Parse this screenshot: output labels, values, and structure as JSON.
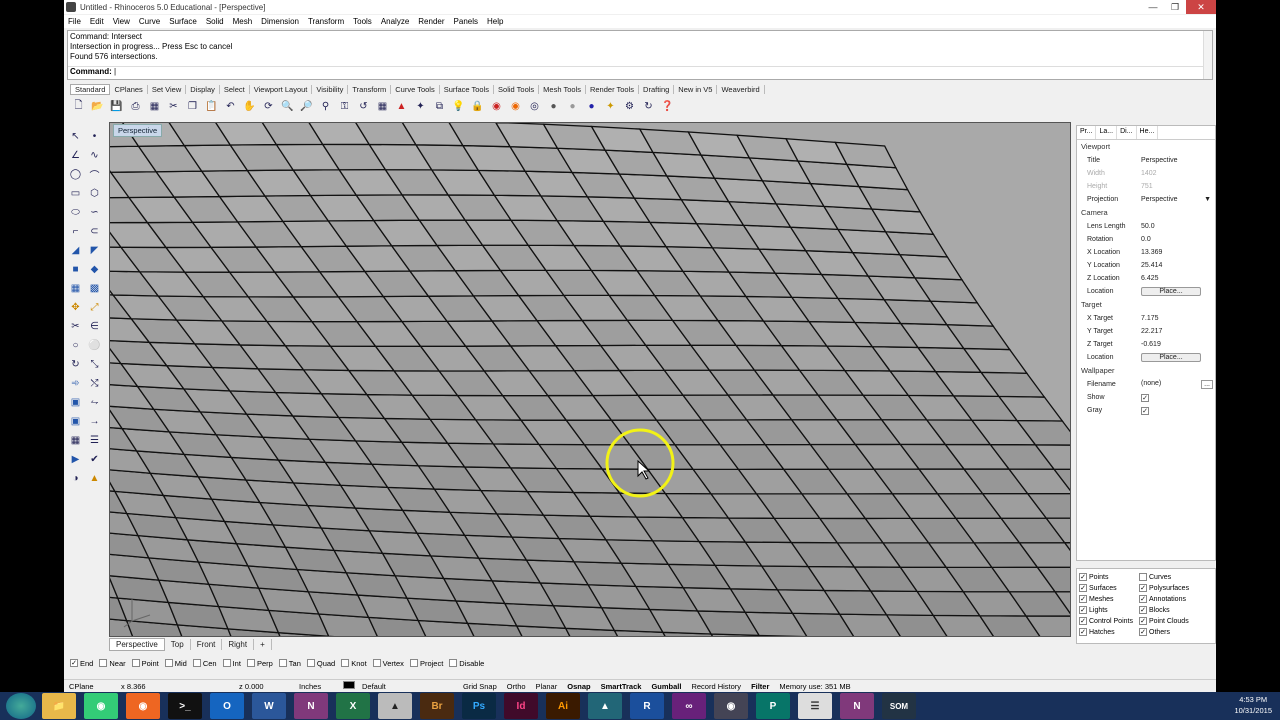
{
  "window": {
    "title": "Untitled - Rhinoceros 5.0 Educational - [Perspective]"
  },
  "menu": [
    "File",
    "Edit",
    "View",
    "Curve",
    "Surface",
    "Solid",
    "Mesh",
    "Dimension",
    "Transform",
    "Tools",
    "Analyze",
    "Render",
    "Panels",
    "Help"
  ],
  "command": {
    "history": [
      "Command: Intersect",
      "Intersection in progress... Press Esc to cancel",
      "Found 576 intersections."
    ],
    "prompt_label": "Command:"
  },
  "toolbar_tabs": [
    "Standard",
    "CPlanes",
    "Set View",
    "Display",
    "Select",
    "Viewport Layout",
    "Visibility",
    "Transform",
    "Curve Tools",
    "Surface Tools",
    "Solid Tools",
    "Mesh Tools",
    "Render Tools",
    "Drafting",
    "New in V5",
    "Weaverbird"
  ],
  "viewport": {
    "label": "Perspective"
  },
  "view_tabs": [
    "Perspective",
    "Top",
    "Front",
    "Right",
    "+"
  ],
  "osnaps": [
    {
      "label": "End",
      "checked": true
    },
    {
      "label": "Near",
      "checked": false
    },
    {
      "label": "Point",
      "checked": false
    },
    {
      "label": "Mid",
      "checked": false
    },
    {
      "label": "Cen",
      "checked": false
    },
    {
      "label": "Int",
      "checked": false
    },
    {
      "label": "Perp",
      "checked": false
    },
    {
      "label": "Tan",
      "checked": false
    },
    {
      "label": "Quad",
      "checked": false
    },
    {
      "label": "Knot",
      "checked": false
    },
    {
      "label": "Vertex",
      "checked": false
    },
    {
      "label": "Project",
      "checked": false
    },
    {
      "label": "Disable",
      "checked": false
    }
  ],
  "status": {
    "cplane": "CPlane",
    "x": "x 8.366",
    "z": "z 0.000",
    "units": "Inches",
    "layer": "Default",
    "grid_snap": "Grid Snap",
    "ortho": "Ortho",
    "planar": "Planar",
    "osnap": "Osnap",
    "smarttrack": "SmartTrack",
    "gumball": "Gumball",
    "record_history": "Record History",
    "filter": "Filter",
    "memory": "Memory use: 351 MB"
  },
  "properties": {
    "tabs": [
      "Pr...",
      "La...",
      "Di...",
      "He..."
    ],
    "viewport_header": "Viewport",
    "title_k": "Title",
    "title_v": "Perspective",
    "width_k": "Width",
    "width_v": "1402",
    "height_k": "Height",
    "height_v": "751",
    "projection_k": "Projection",
    "projection_v": "Perspective",
    "camera_header": "Camera",
    "lens_k": "Lens Length",
    "lens_v": "50.0",
    "rotation_k": "Rotation",
    "rotation_v": "0.0",
    "xloc_k": "X Location",
    "xloc_v": "13.369",
    "yloc_k": "Y Location",
    "yloc_v": "25.414",
    "zloc_k": "Z Location",
    "zloc_v": "6.425",
    "location_k": "Location",
    "place_btn": "Place...",
    "target_header": "Target",
    "xt_k": "X Target",
    "xt_v": "7.175",
    "yt_k": "Y Target",
    "yt_v": "22.217",
    "zt_k": "Z Target",
    "zt_v": "-0.619",
    "tlocation_k": "Location",
    "tplace_btn": "Place...",
    "wallpaper_header": "Wallpaper",
    "filename_k": "Filename",
    "filename_v": "(none)",
    "show_k": "Show",
    "gray_k": "Gray"
  },
  "filter_items": [
    "Points",
    "Curves",
    "Surfaces",
    "Polysurfaces",
    "Meshes",
    "Annotations",
    "Lights",
    "Blocks",
    "Control Points",
    "Point Clouds",
    "Hatches",
    "Others"
  ],
  "filter_checked": [
    true,
    false,
    true,
    true,
    true,
    true,
    true,
    true,
    true,
    true,
    true,
    true
  ],
  "taskbar": {
    "time": "4:53 PM",
    "date": "10/31/2015"
  },
  "colors": {
    "viewport_bg": "#a9a9a9",
    "panel_surface": "#9a9a9a",
    "highlight": "#f2f216",
    "taskbar": "#18305a"
  }
}
